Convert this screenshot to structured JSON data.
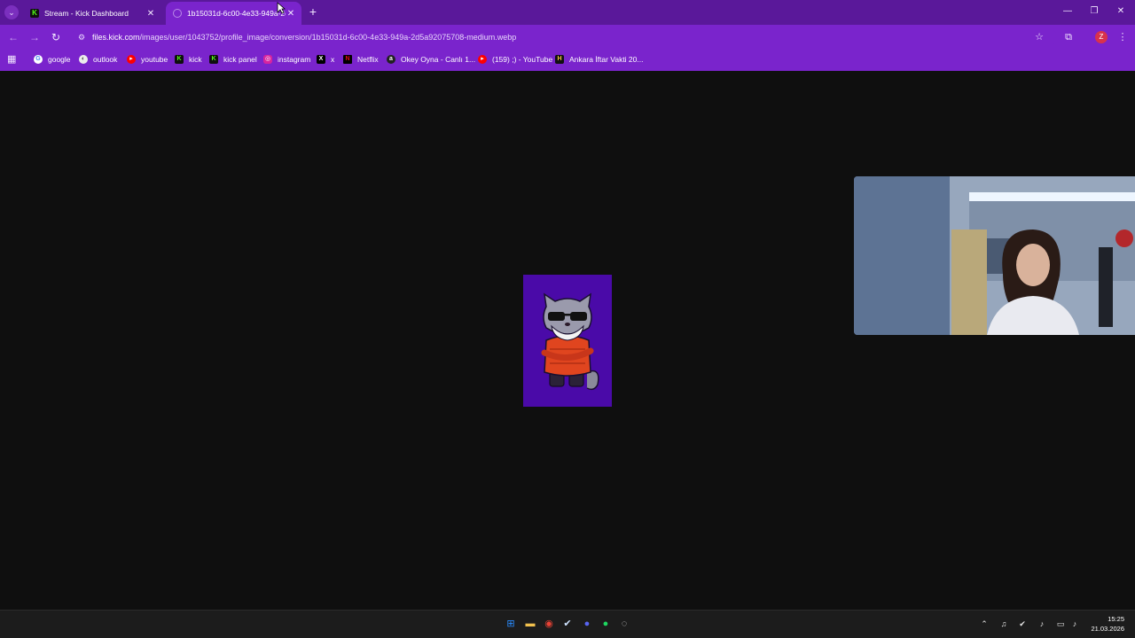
{
  "browser": {
    "tabs": [
      {
        "title": "Stream - Kick Dashboard",
        "favicon": "kick-icon",
        "active": false
      },
      {
        "title": "1b15031d-6c00-4e33-949a-2c",
        "favicon": "image-icon",
        "active": true
      }
    ],
    "new_tab_glyph": "+",
    "close_glyph": "✕",
    "url_host": "files.kick.com",
    "url_path": "/images/user/1043752/profile_image/conversion/1b15031d-6c00-4e33-949a-2d5a92075708-medium.webp",
    "profile_initial": "Z",
    "accent": "#7a24cc",
    "tabstrip_color": "#5a189a"
  },
  "bookmarks": [
    {
      "label": "google",
      "icon": "google-icon"
    },
    {
      "label": "outlook",
      "icon": "outlook-icon"
    },
    {
      "label": "youtube",
      "icon": "youtube-icon"
    },
    {
      "label": "kick",
      "icon": "kick-icon"
    },
    {
      "label": "kick panel",
      "icon": "kick-icon"
    },
    {
      "label": "instagram",
      "icon": "instagram-icon"
    },
    {
      "label": "x",
      "icon": "x-icon"
    },
    {
      "label": "Netflix",
      "icon": "netflix-icon"
    },
    {
      "label": "Okey Oyna - Canlı 1...",
      "icon": "okey-icon"
    },
    {
      "label": "(159) ;) - YouTube",
      "icon": "youtube-icon"
    },
    {
      "label": "Ankara İftar Vakti 20...",
      "icon": "ankara-icon"
    }
  ],
  "taskbar": {
    "time": "15:25",
    "date": "21.03.2026"
  }
}
